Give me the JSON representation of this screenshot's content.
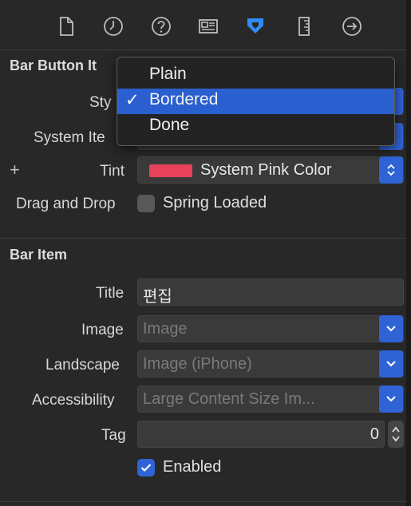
{
  "toolbar": {
    "icons": [
      "file-icon",
      "clock-icon",
      "help-icon",
      "inspector-icon",
      "attributes-icon",
      "size-icon",
      "connections-icon"
    ],
    "active": "attributes-icon",
    "accent": "#2f8cf5"
  },
  "bar_button_item": {
    "section_title": "Bar Button It",
    "style_label": "Sty",
    "system_item_label": "System Ite",
    "tint_label": "Tint",
    "tint_value": "System Pink Color",
    "tint_color": "#e8415a",
    "drag_drop_label": "Drag and Drop",
    "spring_loaded_label": "Spring Loaded",
    "spring_loaded_checked": false
  },
  "style_menu": {
    "items": [
      "Plain",
      "Bordered",
      "Done"
    ],
    "selected": "Bordered",
    "check": "✓"
  },
  "bar_item": {
    "section_title": "Bar Item",
    "title_label": "Title",
    "title_value": "편집",
    "image_label": "Image",
    "image_placeholder": "Image",
    "landscape_label": "Landscape",
    "landscape_placeholder": "Image (iPhone)",
    "accessibility_label": "Accessibility",
    "accessibility_placeholder": "Large Content Size Im...",
    "tag_label": "Tag",
    "tag_value": "0",
    "enabled_label": "Enabled",
    "enabled_checked": true
  },
  "colors": {
    "background": "#282828",
    "control_accent": "#2f63d6",
    "menu_selection": "#2a5fd0"
  }
}
